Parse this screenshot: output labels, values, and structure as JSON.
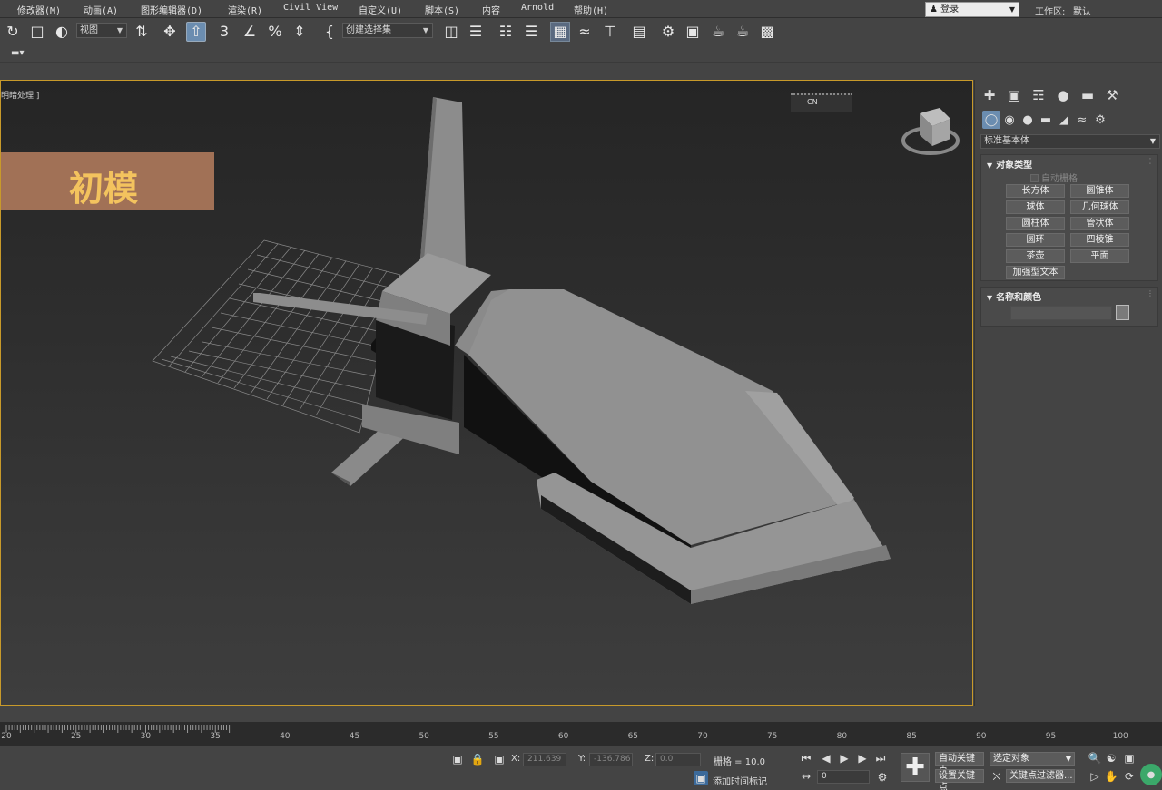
{
  "menu": {
    "items": [
      "修改器(M)",
      "动画(A)",
      "图形编辑器(D)",
      "渲染(R)",
      "Civil View",
      "自定义(U)",
      "脚本(S)",
      "内容",
      "Arnold",
      "帮助(H)"
    ],
    "login": "登录",
    "workspace_label": "工作区:",
    "workspace_value": "默认"
  },
  "toolbar": {
    "view_dropdown": "视图",
    "selection_set": "创建选择集"
  },
  "viewport": {
    "label": "明暗处理 ]",
    "title_overlay": "初模",
    "chip_text": "CN"
  },
  "command_panel": {
    "category": "标准基本体",
    "object_type": {
      "header": "对象类型",
      "autogrid": "自动栅格",
      "buttons": [
        "长方体",
        "圆锥体",
        "球体",
        "几何球体",
        "圆柱体",
        "管状体",
        "圆环",
        "四棱锥",
        "茶壶",
        "平面",
        "加强型文本"
      ]
    },
    "name_color": {
      "header": "名称和颜色"
    }
  },
  "timeline": {
    "tick_labels": [
      "20",
      "25",
      "30",
      "35",
      "40",
      "45",
      "50",
      "55",
      "60",
      "65",
      "70",
      "75",
      "80",
      "85",
      "90",
      "95",
      "100"
    ]
  },
  "status": {
    "x_label": "X:",
    "x_value": "211.639",
    "y_label": "Y:",
    "y_value": "-136.786",
    "z_label": "Z:",
    "z_value": "0.0",
    "grid": "栅格 = 10.0",
    "add_time_tag": "添加时间标记",
    "frame_value": "0",
    "auto_key": "自动关键点",
    "set_key": "设置关键点",
    "selected_object": "选定对象",
    "key_filters": "关键点过滤器..."
  }
}
